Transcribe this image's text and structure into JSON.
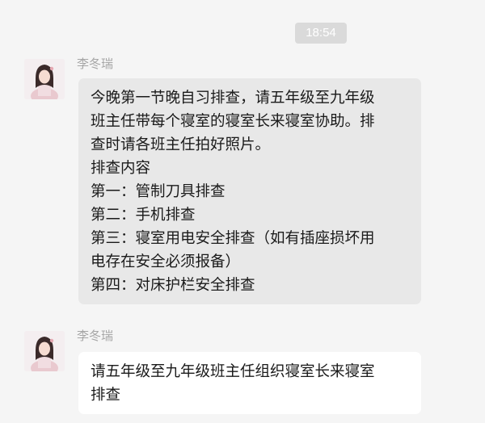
{
  "chat": {
    "timestamp": "18:54",
    "messages": [
      {
        "sender": "李冬瑞",
        "avatar": "profile-photo",
        "lines": [
          "今晚第一节晚自习排查，请五年级至九年级",
          "班主任带每个寝室的寝室长来寝室协助。排",
          "查时请各班主任拍好照片。",
          "排查内容",
          "第一：管制刀具排查",
          "第二：手机排查",
          "第三：寝室用电安全排查（如有插座损坏用",
          "电存在安全必须报备）",
          "第四：对床护栏安全排查"
        ]
      },
      {
        "sender": "李冬瑞",
        "avatar": "profile-photo",
        "lines": [
          "请五年级至九年级班主任组织寝室长来寝室",
          "排查"
        ]
      }
    ]
  }
}
